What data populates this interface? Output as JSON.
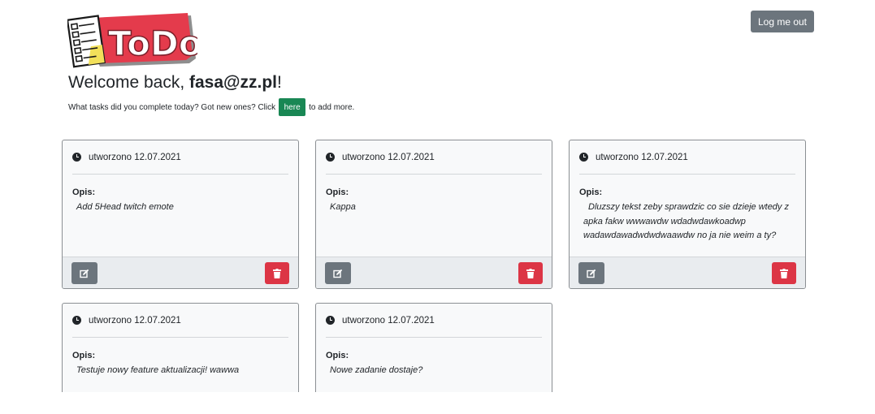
{
  "header": {
    "logo_text": "ToDo",
    "logout_label": "Log me out"
  },
  "welcome": {
    "prefix": "Welcome back, ",
    "email": "fasa@zz.pl",
    "suffix": "!"
  },
  "subline": {
    "before": "What tasks did you complete today? Got new ones? Click",
    "here_label": "here",
    "after": "to add more."
  },
  "cards": [
    {
      "created": "utworzono 12.07.2021",
      "opis_label": "Opis:",
      "description": "Add 5Head twitch emote"
    },
    {
      "created": "utworzono 12.07.2021",
      "opis_label": "Opis:",
      "description": "Kappa"
    },
    {
      "created": "utworzono 12.07.2021",
      "opis_label": "Opis:",
      "description": "Dluzszy tekst zeby sprawdzic co sie dzieje wtedy z apka fakw wwwawdw wdadwdawkoadwp wadawdawadwdwdwaawdw no ja nie weim a ty?"
    },
    {
      "created": "utworzono 12.07.2021",
      "opis_label": "Opis:",
      "description": "Testuje nowy feature aktualizacji! wawwa"
    },
    {
      "created": "utworzono 12.07.2021",
      "opis_label": "Opis:",
      "description": "Nowe zadanie dostaje?"
    }
  ],
  "icons": {
    "card_header": "clock-icon",
    "edit": "edit-icon",
    "delete": "trash-icon"
  },
  "colors": {
    "logo_red": "#e43b4c",
    "secondary": "#6c757d",
    "success": "#198754",
    "danger": "#dc3545"
  }
}
